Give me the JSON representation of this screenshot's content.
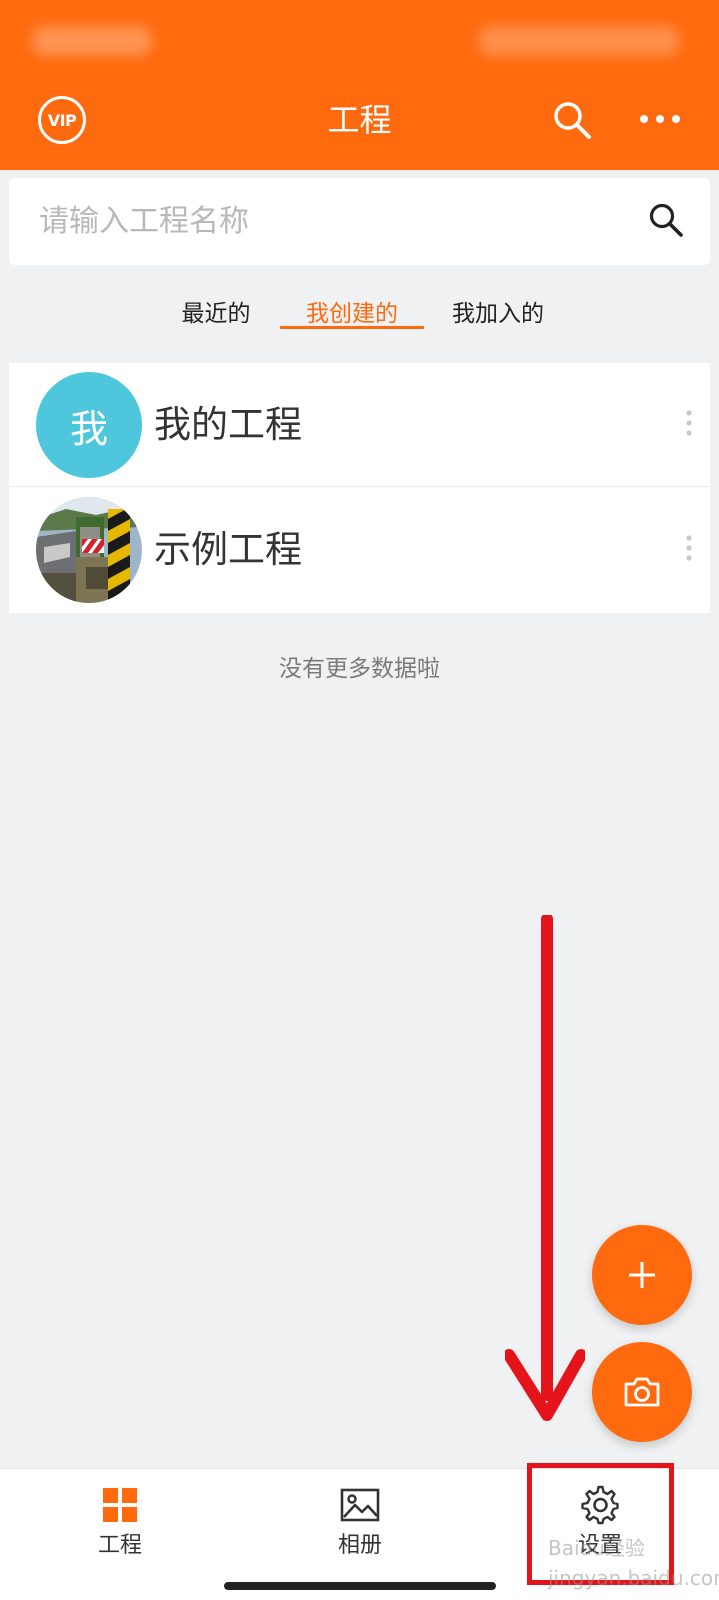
{
  "header": {
    "title": "工程",
    "vip_badge": "VIP",
    "background_color": "#ff6a0e",
    "search_icon": "search-icon",
    "more_icon": "more-horizontal-icon"
  },
  "search": {
    "placeholder": "请输入工程名称",
    "value": "",
    "icon": "search-icon"
  },
  "tabs": [
    {
      "label": "最近的",
      "active": false
    },
    {
      "label": "我创建的",
      "active": true
    },
    {
      "label": "我加入的",
      "active": false
    }
  ],
  "projects": [
    {
      "name": "我的工程",
      "avatar_text": "我",
      "avatar_color": "#4ec7dd"
    },
    {
      "name": "示例工程",
      "avatar": "roadside-photo-thumbnail"
    }
  ],
  "list_end_text": "没有更多数据啦",
  "fab": {
    "add_icon": "plus-icon",
    "camera_icon": "camera-icon"
  },
  "bottom_nav": [
    {
      "label": "工程",
      "icon": "grid-icon",
      "active": true
    },
    {
      "label": "相册",
      "icon": "image-icon",
      "active": false
    },
    {
      "label": "设置",
      "icon": "gear-icon",
      "active": false
    }
  ],
  "annotation": {
    "color": "#e4141a",
    "arrow": "down-arrow",
    "highlight": "settings-tab"
  },
  "watermark": "Baidu经验 jingyan.baidu.com"
}
